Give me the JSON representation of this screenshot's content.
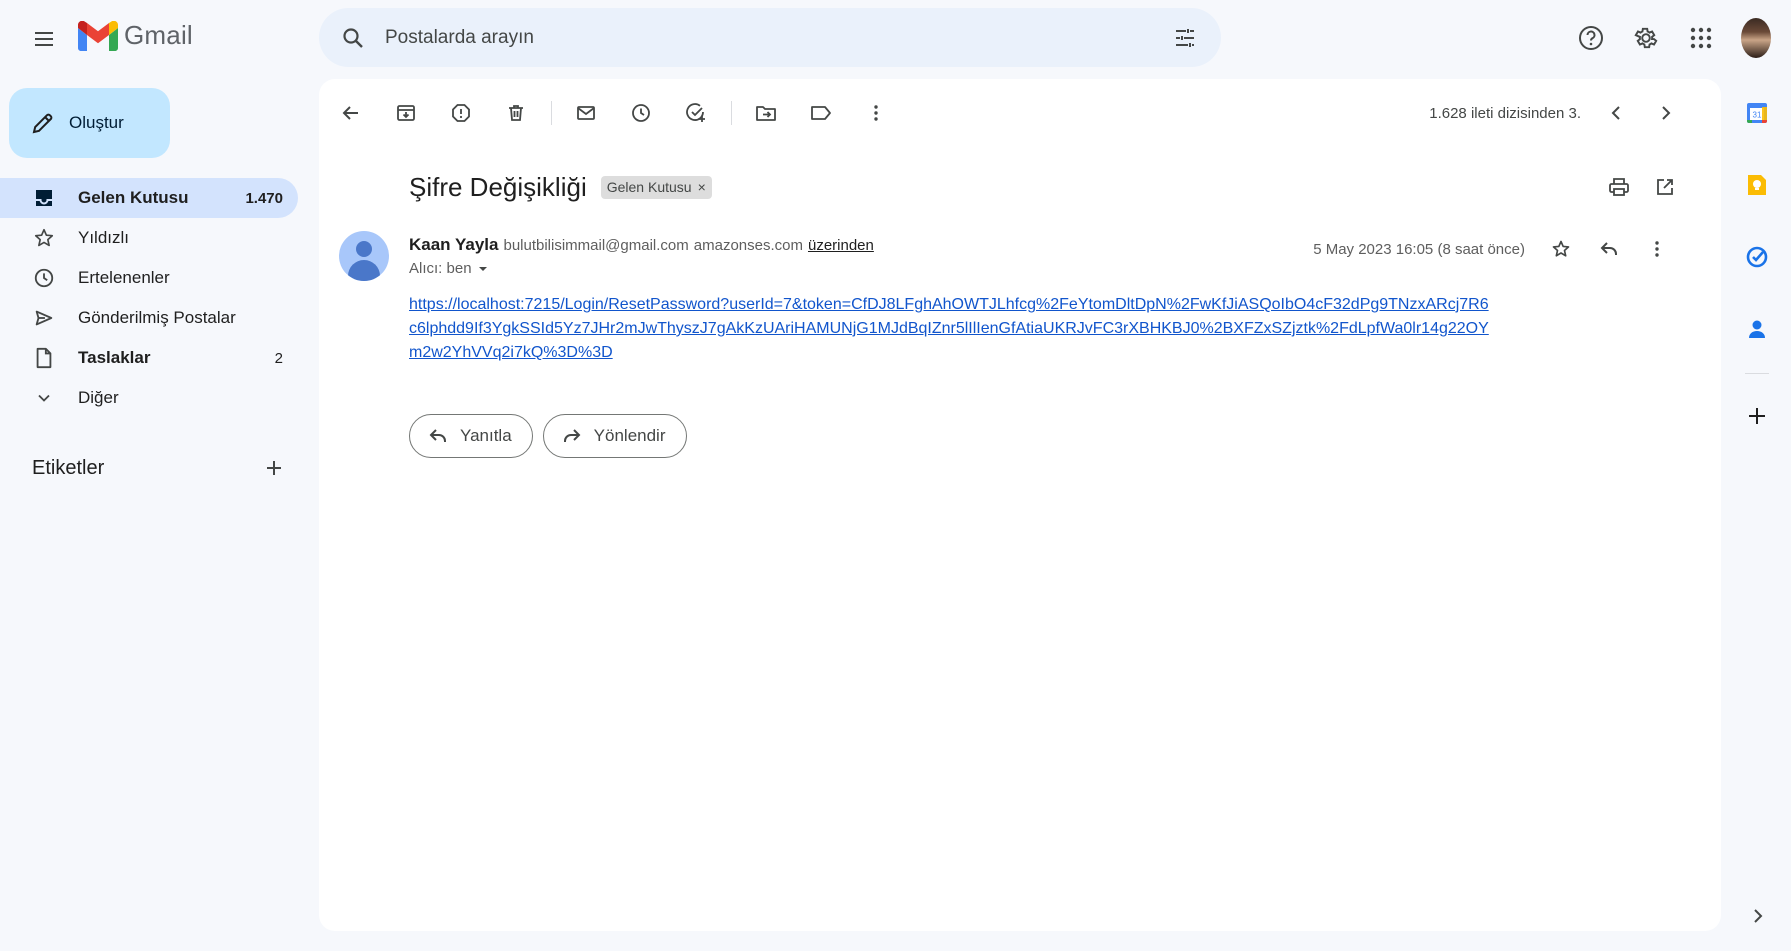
{
  "app": {
    "name": "Gmail",
    "brand_colors": {
      "red": "#ea4335",
      "blue": "#4285f4",
      "green": "#34a853",
      "yellow": "#fbbc04"
    }
  },
  "search": {
    "placeholder": "Postalarda arayın"
  },
  "top_icons": [
    "help-icon",
    "settings-icon",
    "apps-icon",
    "account-avatar"
  ],
  "compose": {
    "label": "Oluştur"
  },
  "sidebar": {
    "items": [
      {
        "label": "Gelen Kutusu",
        "count": "1.470",
        "icon": "inbox-icon",
        "active": true,
        "bold": true
      },
      {
        "label": "Yıldızlı",
        "count": "",
        "icon": "star-icon"
      },
      {
        "label": "Ertelenenler",
        "count": "",
        "icon": "clock-icon"
      },
      {
        "label": "Gönderilmiş Postalar",
        "count": "",
        "icon": "send-icon"
      },
      {
        "label": "Taslaklar",
        "count": "2",
        "icon": "draft-icon",
        "bold": true
      },
      {
        "label": "Diğer",
        "count": "",
        "icon": "chevron-down-icon"
      }
    ],
    "labels_heading": "Etiketler"
  },
  "toolbar": {
    "paging_text": "1.628 ileti dizisinden 3."
  },
  "message": {
    "subject": "Şifre Değişikliği",
    "label_chip": "Gelen Kutusu",
    "label_chip_close": "×",
    "sender_name": "Kaan Yayla",
    "sender_email": "bulutbilisimmail@gmail.com",
    "sender_via": "amazonses.com",
    "sender_via_link": "üzerinden",
    "recipient": "Alıcı: ben",
    "date": "5 May 2023 16:05 (8 saat önce)",
    "link": "https://localhost:7215/Login/ResetPassword?userId=7&token=CfDJ8LFghAhOWTJLhfcg%2FeYtomDltDpN%2FwKfJiASQoIbO4cF32dPg9TNzxARcj7R6c6lphdd9If3YgkSSId5Yz7JHr2mJwThyszJ7gAkKzUAriHAMUNjG1MJdBqIZnr5lIlIenGfAtiaUKRJvFC3rXBHKBJ0%2BXFZxSZjztk%2FdLpfWa0lr14g22OYm2w2YhVVq2i7kQ%3D%3D",
    "link_color": "#1155cc"
  },
  "actions": {
    "reply": "Yanıtla",
    "forward": "Yönlendir"
  }
}
